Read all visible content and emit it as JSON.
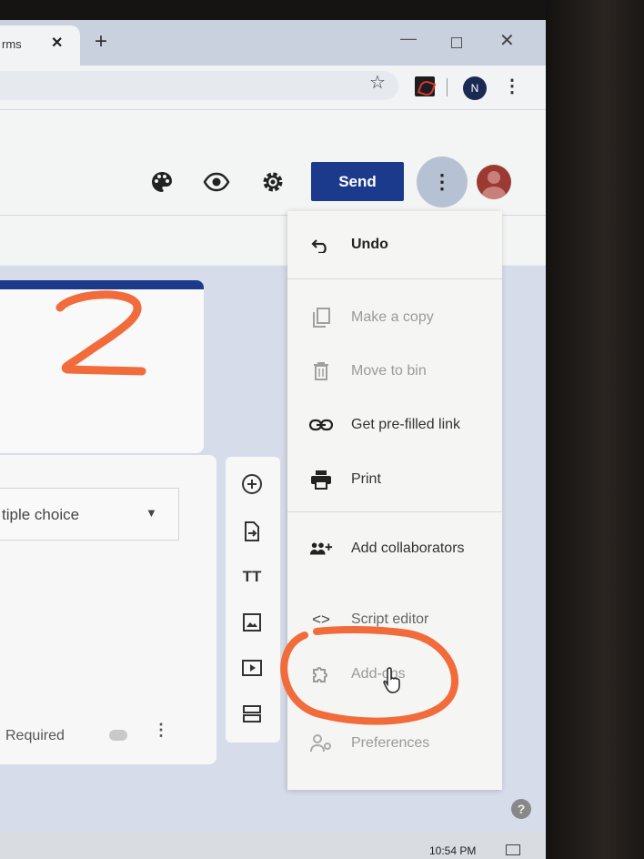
{
  "browser": {
    "tab_title": "rms",
    "tab_close": "✕",
    "new_tab": "+",
    "window_min": "—",
    "window_close": "✕",
    "profile_initial": "N"
  },
  "header": {
    "send_label": "Send",
    "icons": [
      "palette-icon",
      "eye-icon",
      "gear-icon",
      "more-vert-icon"
    ]
  },
  "form": {
    "question_type": "tiple choice",
    "required_label": "Required"
  },
  "tools": [
    "add-question-icon",
    "import-questions-icon",
    "title-text-icon",
    "image-icon",
    "video-icon",
    "section-icon"
  ],
  "menu": {
    "items": [
      {
        "label": "Undo",
        "icon": "undo-icon",
        "enabled": true
      },
      {
        "label": "Make a copy",
        "icon": "copy-icon",
        "enabled": false
      },
      {
        "label": "Move to bin",
        "icon": "bin-icon",
        "enabled": false
      },
      {
        "label": "Get pre-filled link",
        "icon": "link-icon",
        "enabled": true
      },
      {
        "label": "Print",
        "icon": "printer-icon",
        "enabled": true
      },
      {
        "label": "Add collaborators",
        "icon": "add-people-icon",
        "enabled": true
      },
      {
        "label": "Script editor",
        "icon": "code-icon",
        "enabled": true
      },
      {
        "label": "Add-ons",
        "icon": "puzzle-icon",
        "enabled": false
      },
      {
        "label": "Preferences",
        "icon": "person-settings-icon",
        "enabled": false
      }
    ]
  },
  "annotation": {
    "step_number": "2",
    "color": "#f26b3a"
  },
  "taskbar": {
    "clock": "10:54 PM"
  },
  "colors": {
    "send_button": "#1b3a8c",
    "form_accent": "#1b3a8c"
  }
}
